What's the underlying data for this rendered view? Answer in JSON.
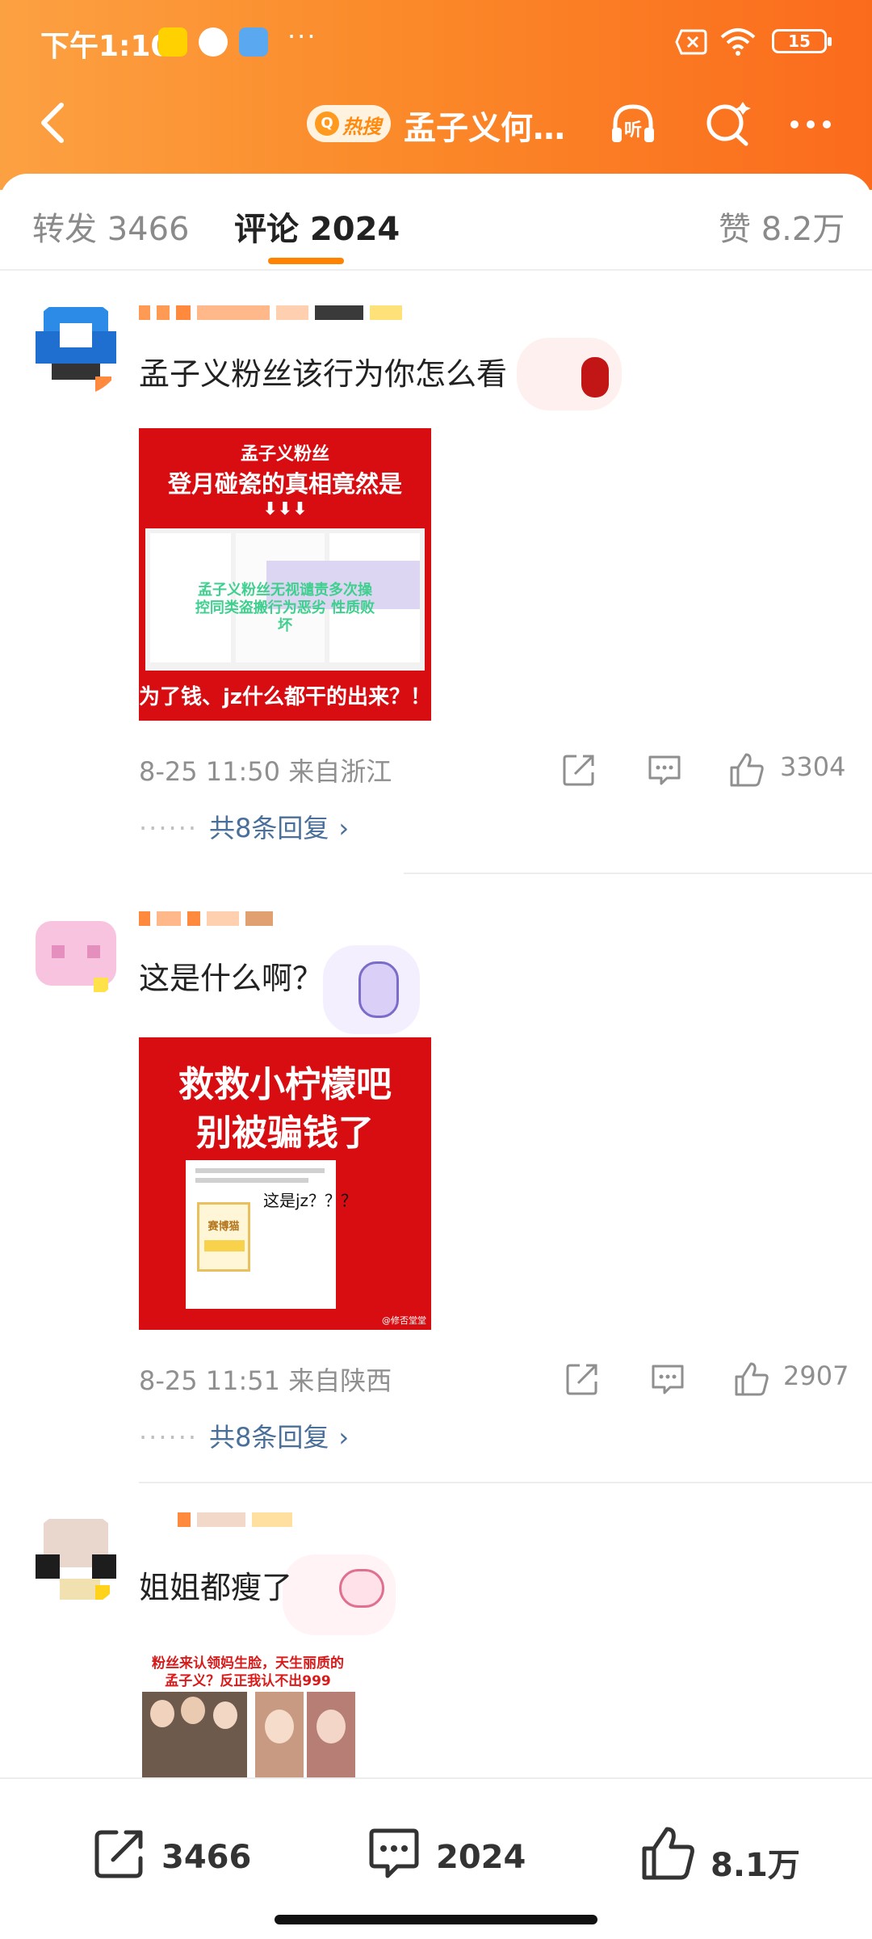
{
  "status_bar": {
    "time": "下午1:10",
    "battery": "15",
    "more": "···"
  },
  "nav": {
    "hot_label": "热搜",
    "title": "孟子义何…"
  },
  "tabs": [
    {
      "label": "转发 3466"
    },
    {
      "label": "评论 2024"
    },
    {
      "label": "赞 8.2万"
    }
  ],
  "comments": [
    {
      "text": "孟子义粉丝该行为你怎么看",
      "image": {
        "line1": "孟子义粉丝",
        "line2": "登月碰瓷的真相竟然是",
        "arrows": "⬇⬇⬇",
        "overlay": "孟子义粉丝无视谴责多次操控同类盗搬行为恶劣 性质败坏",
        "bottom": "为了钱、jz什么都干的出来？！"
      },
      "meta": "8-25 11:50  来自浙江",
      "likes": "3304",
      "replies": "共8条回复"
    },
    {
      "text": "这是什么啊？",
      "image": {
        "line1": "救救小柠檬吧",
        "line2": "别被骗钱了",
        "inner": "这是jz？？？",
        "inner_badge": "赛博猫",
        "watermark": "@修否堂堂"
      },
      "meta": "8-25 11:51  来自陕西",
      "likes": "2907",
      "replies": "共8条回复"
    },
    {
      "text": "姐姐都瘦了",
      "image": {
        "line1": "粉丝来认领妈生脸，天生丽质的",
        "line2": "孟子义？反正我认不出999"
      }
    }
  ],
  "bottom_bar": {
    "repost": "3466",
    "comment": "2024",
    "like": "8.1万"
  },
  "colors": {
    "accent": "#ff8200",
    "topbar_start": "#fca142",
    "topbar_end": "#fb6b1c",
    "link": "#4a6f9a",
    "image_red": "#d80d12"
  }
}
